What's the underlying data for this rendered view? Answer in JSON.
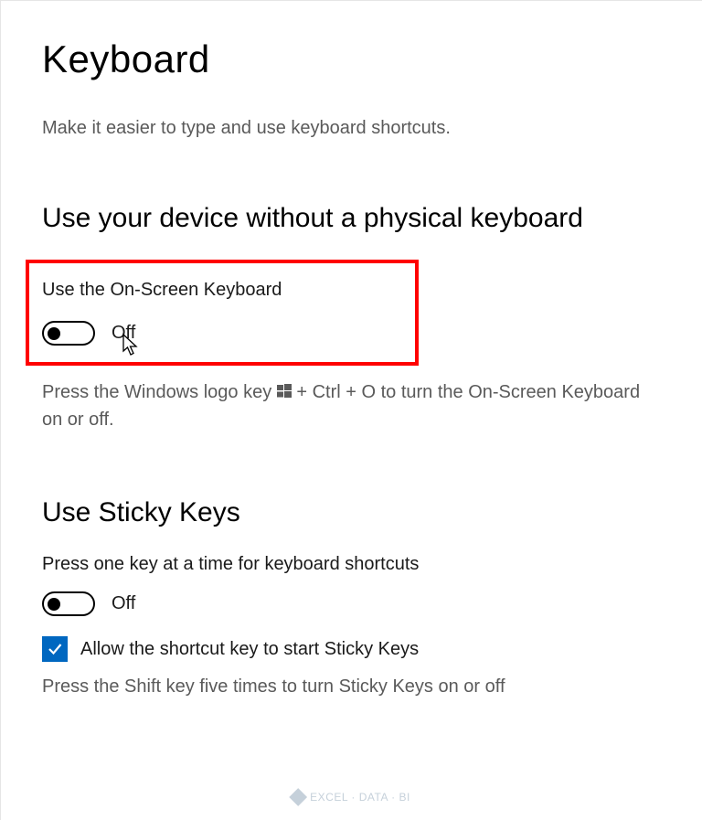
{
  "page": {
    "title": "Keyboard",
    "subtitle": "Make it easier to type and use keyboard shortcuts."
  },
  "onscreen": {
    "heading": "Use your device without a physical keyboard",
    "label": "Use the On-Screen Keyboard",
    "state": "Off",
    "help_before": "Press the Windows logo key ",
    "help_after": " + Ctrl + O to turn the On-Screen Keyboard on or off."
  },
  "sticky": {
    "heading": "Use Sticky Keys",
    "label": "Press one key at a time for keyboard shortcuts",
    "state": "Off",
    "checkbox_label": "Allow the shortcut key to start Sticky Keys",
    "checkbox_checked": true,
    "help": "Press the Shift key five times to turn Sticky Keys on or off"
  },
  "watermark": "EXCEL · DATA · BI"
}
